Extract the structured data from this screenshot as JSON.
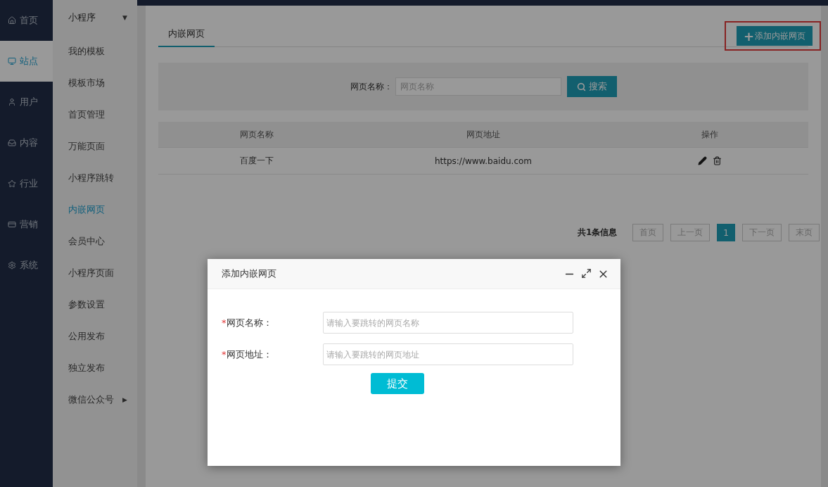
{
  "main_nav": [
    {
      "label": "首页",
      "selected": false
    },
    {
      "label": "站点",
      "selected": true
    },
    {
      "label": "用户",
      "selected": false
    },
    {
      "label": "内容",
      "selected": false
    },
    {
      "label": "行业",
      "selected": false
    },
    {
      "label": "营销",
      "selected": false
    },
    {
      "label": "系统",
      "selected": false
    }
  ],
  "sub_nav": {
    "header": "小程序",
    "header_caret": "▼",
    "items": [
      {
        "label": "我的模板",
        "selected": false
      },
      {
        "label": "模板市场",
        "selected": false
      },
      {
        "label": "首页管理",
        "selected": false
      },
      {
        "label": "万能页面",
        "selected": false
      },
      {
        "label": "小程序跳转",
        "selected": false
      },
      {
        "label": "内嵌网页",
        "selected": true
      },
      {
        "label": "会员中心",
        "selected": false
      },
      {
        "label": "小程序页面",
        "selected": false
      },
      {
        "label": "参数设置",
        "selected": false
      },
      {
        "label": "公用发布",
        "selected": false
      },
      {
        "label": "独立发布",
        "selected": false
      },
      {
        "label": "微信公众号",
        "selected": false,
        "caret": "▶"
      }
    ]
  },
  "tabs": [
    {
      "label": "内嵌网页",
      "selected": true
    }
  ],
  "add_button": {
    "icon": "+",
    "label": "添加内嵌网页"
  },
  "search": {
    "label": "网页名称：",
    "placeholder": "网页名称",
    "button": "搜索"
  },
  "table": {
    "columns": [
      "网页名称",
      "网页地址",
      "操作"
    ],
    "rows": [
      {
        "name": "百度一下",
        "url": "https://www.baidu.com"
      }
    ]
  },
  "pagination": {
    "summary": "共1条信息",
    "pages": [
      {
        "label": "首页",
        "selected": false
      },
      {
        "label": "上一页",
        "selected": false
      },
      {
        "label": "1",
        "selected": true
      },
      {
        "label": "下一页",
        "selected": false
      },
      {
        "label": "末页",
        "selected": false
      }
    ]
  },
  "dialog": {
    "title": "添加内嵌网页",
    "fields": [
      {
        "marker": "*",
        "label": "网页名称：",
        "placeholder": "请输入要跳转的网页名称"
      },
      {
        "marker": "*",
        "label": "网页地址：",
        "placeholder": "请输入要跳转的网页地址"
      }
    ],
    "submit": "提交"
  }
}
